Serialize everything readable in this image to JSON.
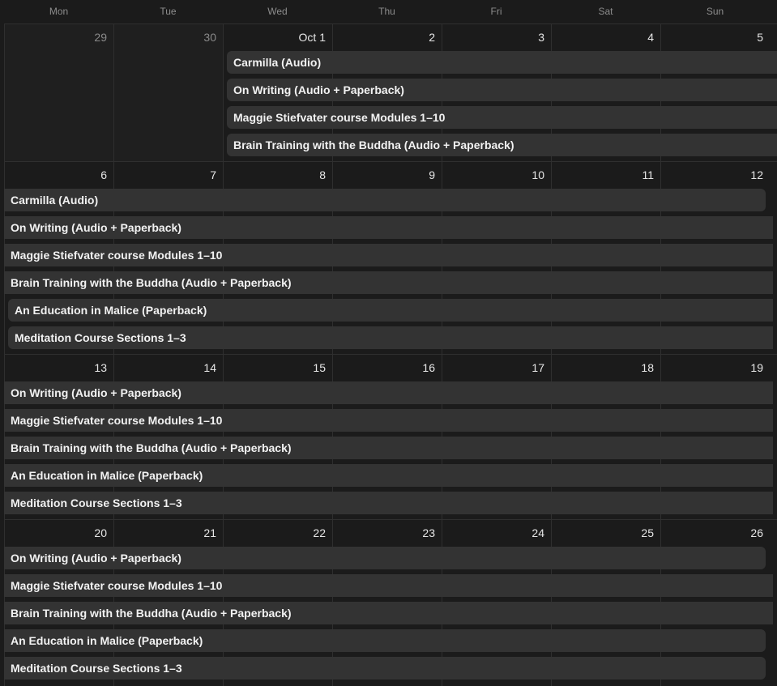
{
  "weekdays": [
    "Mon",
    "Tue",
    "Wed",
    "Thu",
    "Fri",
    "Sat",
    "Sun"
  ],
  "weeks": [
    {
      "days": [
        "29",
        "30",
        "Oct 1",
        "2",
        "3",
        "4",
        "5"
      ],
      "muted": [
        true,
        true,
        false,
        false,
        false,
        false,
        false
      ],
      "events": [
        "Carmilla (Audio)",
        "On Writing (Audio + Paperback)",
        "Maggie Stiefvater course Modules 1–10",
        "Brain Training with the Buddha (Audio + Paperback)"
      ]
    },
    {
      "days": [
        "6",
        "7",
        "8",
        "9",
        "10",
        "11",
        "12"
      ],
      "muted": [
        false,
        false,
        false,
        false,
        false,
        false,
        false
      ],
      "events": [
        "Carmilla (Audio)",
        "On Writing (Audio + Paperback)",
        "Maggie Stiefvater course Modules 1–10",
        "Brain Training with the Buddha (Audio + Paperback)",
        "An Education in Malice (Paperback)",
        "Meditation Course Sections 1–3"
      ]
    },
    {
      "days": [
        "13",
        "14",
        "15",
        "16",
        "17",
        "18",
        "19"
      ],
      "muted": [
        false,
        false,
        false,
        false,
        false,
        false,
        false
      ],
      "events": [
        "On Writing (Audio + Paperback)",
        "Maggie Stiefvater course Modules 1–10",
        "Brain Training with the Buddha (Audio + Paperback)",
        "An Education in Malice (Paperback)",
        "Meditation Course Sections 1–3"
      ]
    },
    {
      "days": [
        "20",
        "21",
        "22",
        "23",
        "24",
        "25",
        "26"
      ],
      "muted": [
        false,
        false,
        false,
        false,
        false,
        false,
        false
      ],
      "events": [
        "On Writing (Audio + Paperback)",
        "Maggie Stiefvater course Modules 1–10",
        "Brain Training with the Buddha (Audio + Paperback)",
        "An Education in Malice (Paperback)",
        "Meditation Course Sections 1–3"
      ]
    }
  ]
}
